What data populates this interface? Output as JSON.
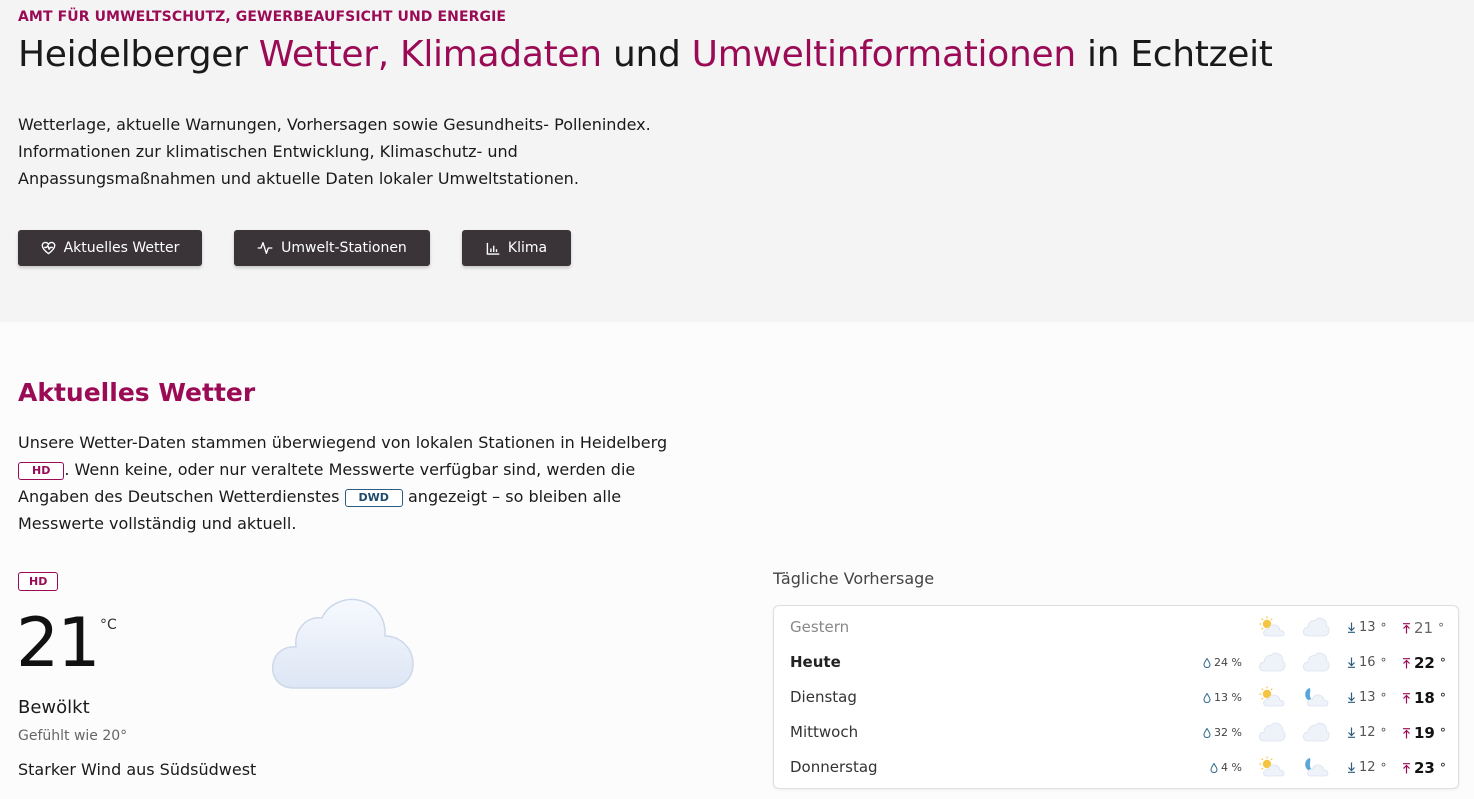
{
  "header": {
    "eyebrow": "AMT FÜR UMWELTSCHUTZ, GEWERBEAUFSICHT UND ENERGIE",
    "title_parts": [
      "Heidelberger ",
      "Wetter, Klimadaten",
      " und ",
      "Umweltinformationen",
      " in Echtzeit"
    ],
    "description_lines": [
      "Wetterlage, aktuelle Warnungen, Vorhersagen sowie Gesundheits- Pollenindex.",
      "Informationen zur klimatischen Entwicklung, Klimaschutz- und",
      "Anpassungsmaßnahmen und aktuelle Daten lokaler Umweltstationen."
    ],
    "buttons": [
      {
        "label": "Aktuelles Wetter",
        "icon": "heart-pulse-icon"
      },
      {
        "label": "Umwelt-Stationen",
        "icon": "activity-icon"
      },
      {
        "label": "Klima",
        "icon": "bar-chart-icon"
      }
    ]
  },
  "weather": {
    "title": "Aktuelles Wetter",
    "desc": {
      "l1": "Unsere Wetter-Daten stammen überwiegend von lokalen Stationen in Heidelberg",
      "badge_hd": "HD",
      "l2": ". Wenn keine, oder nur veraltete Messwerte verfügbar sind, werden die",
      "l3a": "Angaben des Deutschen Wetterdienstes",
      "badge_dwd": "DWD",
      "l3b": "angezeigt – so bleiben alle",
      "l4": "Messwerte vollständig und aktuell."
    },
    "current": {
      "source": "HD",
      "temp": "21",
      "unit": "°C",
      "condition": "Bewölkt",
      "icon": "cloud-icon",
      "feels_like": "Gefühlt wie 20°",
      "wind": "Starker Wind aus Südsüdwest"
    },
    "forecast": {
      "title": "Tägliche Vorhersage",
      "colors": {
        "accent": "#9a0a55",
        "button": "#3a3438",
        "badge_dwd": "#2c5c7f"
      },
      "days": [
        {
          "day": "Gestern",
          "rain": "",
          "icon_day": "partly-sunny-icon",
          "icon_night": "cloud-icon",
          "min": "13",
          "max": "21",
          "style": "past"
        },
        {
          "day": "Heute",
          "rain": "24 %",
          "icon_day": "cloud-icon",
          "icon_night": "cloud-icon",
          "min": "16",
          "max": "22",
          "style": "bold"
        },
        {
          "day": "Dienstag",
          "rain": "13 %",
          "icon_day": "partly-sunny-icon",
          "icon_night": "moon-cloud-icon",
          "min": "13",
          "max": "18",
          "style": ""
        },
        {
          "day": "Mittwoch",
          "rain": "32 %",
          "icon_day": "cloud-icon",
          "icon_night": "cloud-icon",
          "min": "12",
          "max": "19",
          "style": ""
        },
        {
          "day": "Donnerstag",
          "rain": "4 %",
          "icon_day": "partly-sunny-icon",
          "icon_night": "moon-cloud-icon",
          "min": "12",
          "max": "23",
          "style": ""
        }
      ]
    }
  }
}
